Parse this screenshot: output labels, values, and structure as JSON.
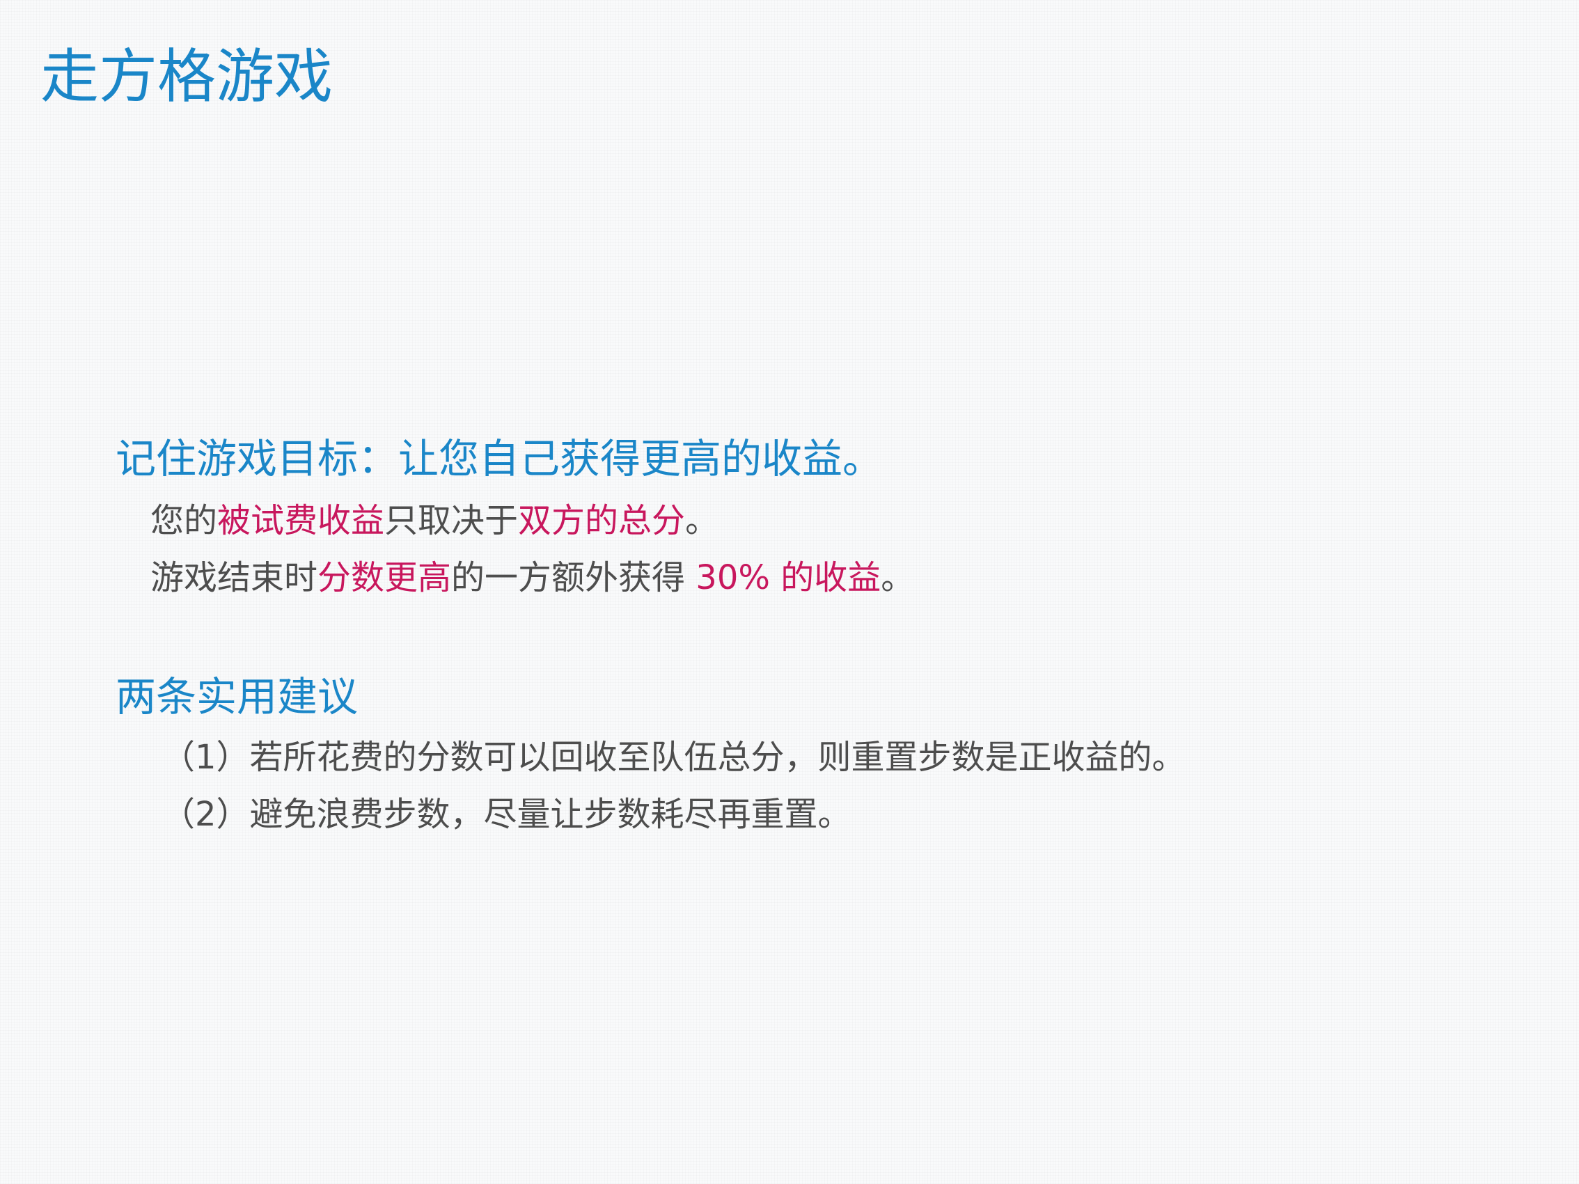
{
  "title": "走方格游戏",
  "sections": [
    {
      "heading": "记住游戏目标：让您自己获得更高的收益。",
      "lines": [
        {
          "segments": [
            {
              "text": "您的",
              "highlight": false
            },
            {
              "text": "被试费收益",
              "highlight": true
            },
            {
              "text": "只取决于",
              "highlight": false
            },
            {
              "text": "双方的总分",
              "highlight": true
            },
            {
              "text": "。",
              "highlight": false
            }
          ]
        },
        {
          "segments": [
            {
              "text": "游戏结束时",
              "highlight": false
            },
            {
              "text": "分数更高",
              "highlight": true
            },
            {
              "text": "的一方额外获得 ",
              "highlight": false
            },
            {
              "text": "30% 的收益",
              "highlight": true
            },
            {
              "text": "。",
              "highlight": false
            }
          ]
        }
      ]
    },
    {
      "heading": "两条实用建议",
      "lines": [
        {
          "segments": [
            {
              "text": "（1）若所花费的分数可以回收至队伍总分，则重置步数是正收益的。",
              "highlight": false
            }
          ]
        },
        {
          "segments": [
            {
              "text": "（2）避免浪费步数，尽量让步数耗尽再重置。",
              "highlight": false
            }
          ]
        }
      ]
    }
  ],
  "colors": {
    "title": "#1a86c8",
    "heading": "#1a86c8",
    "body": "#4d4d4d",
    "highlight": "#c8175d",
    "background": "#f9fafb"
  }
}
